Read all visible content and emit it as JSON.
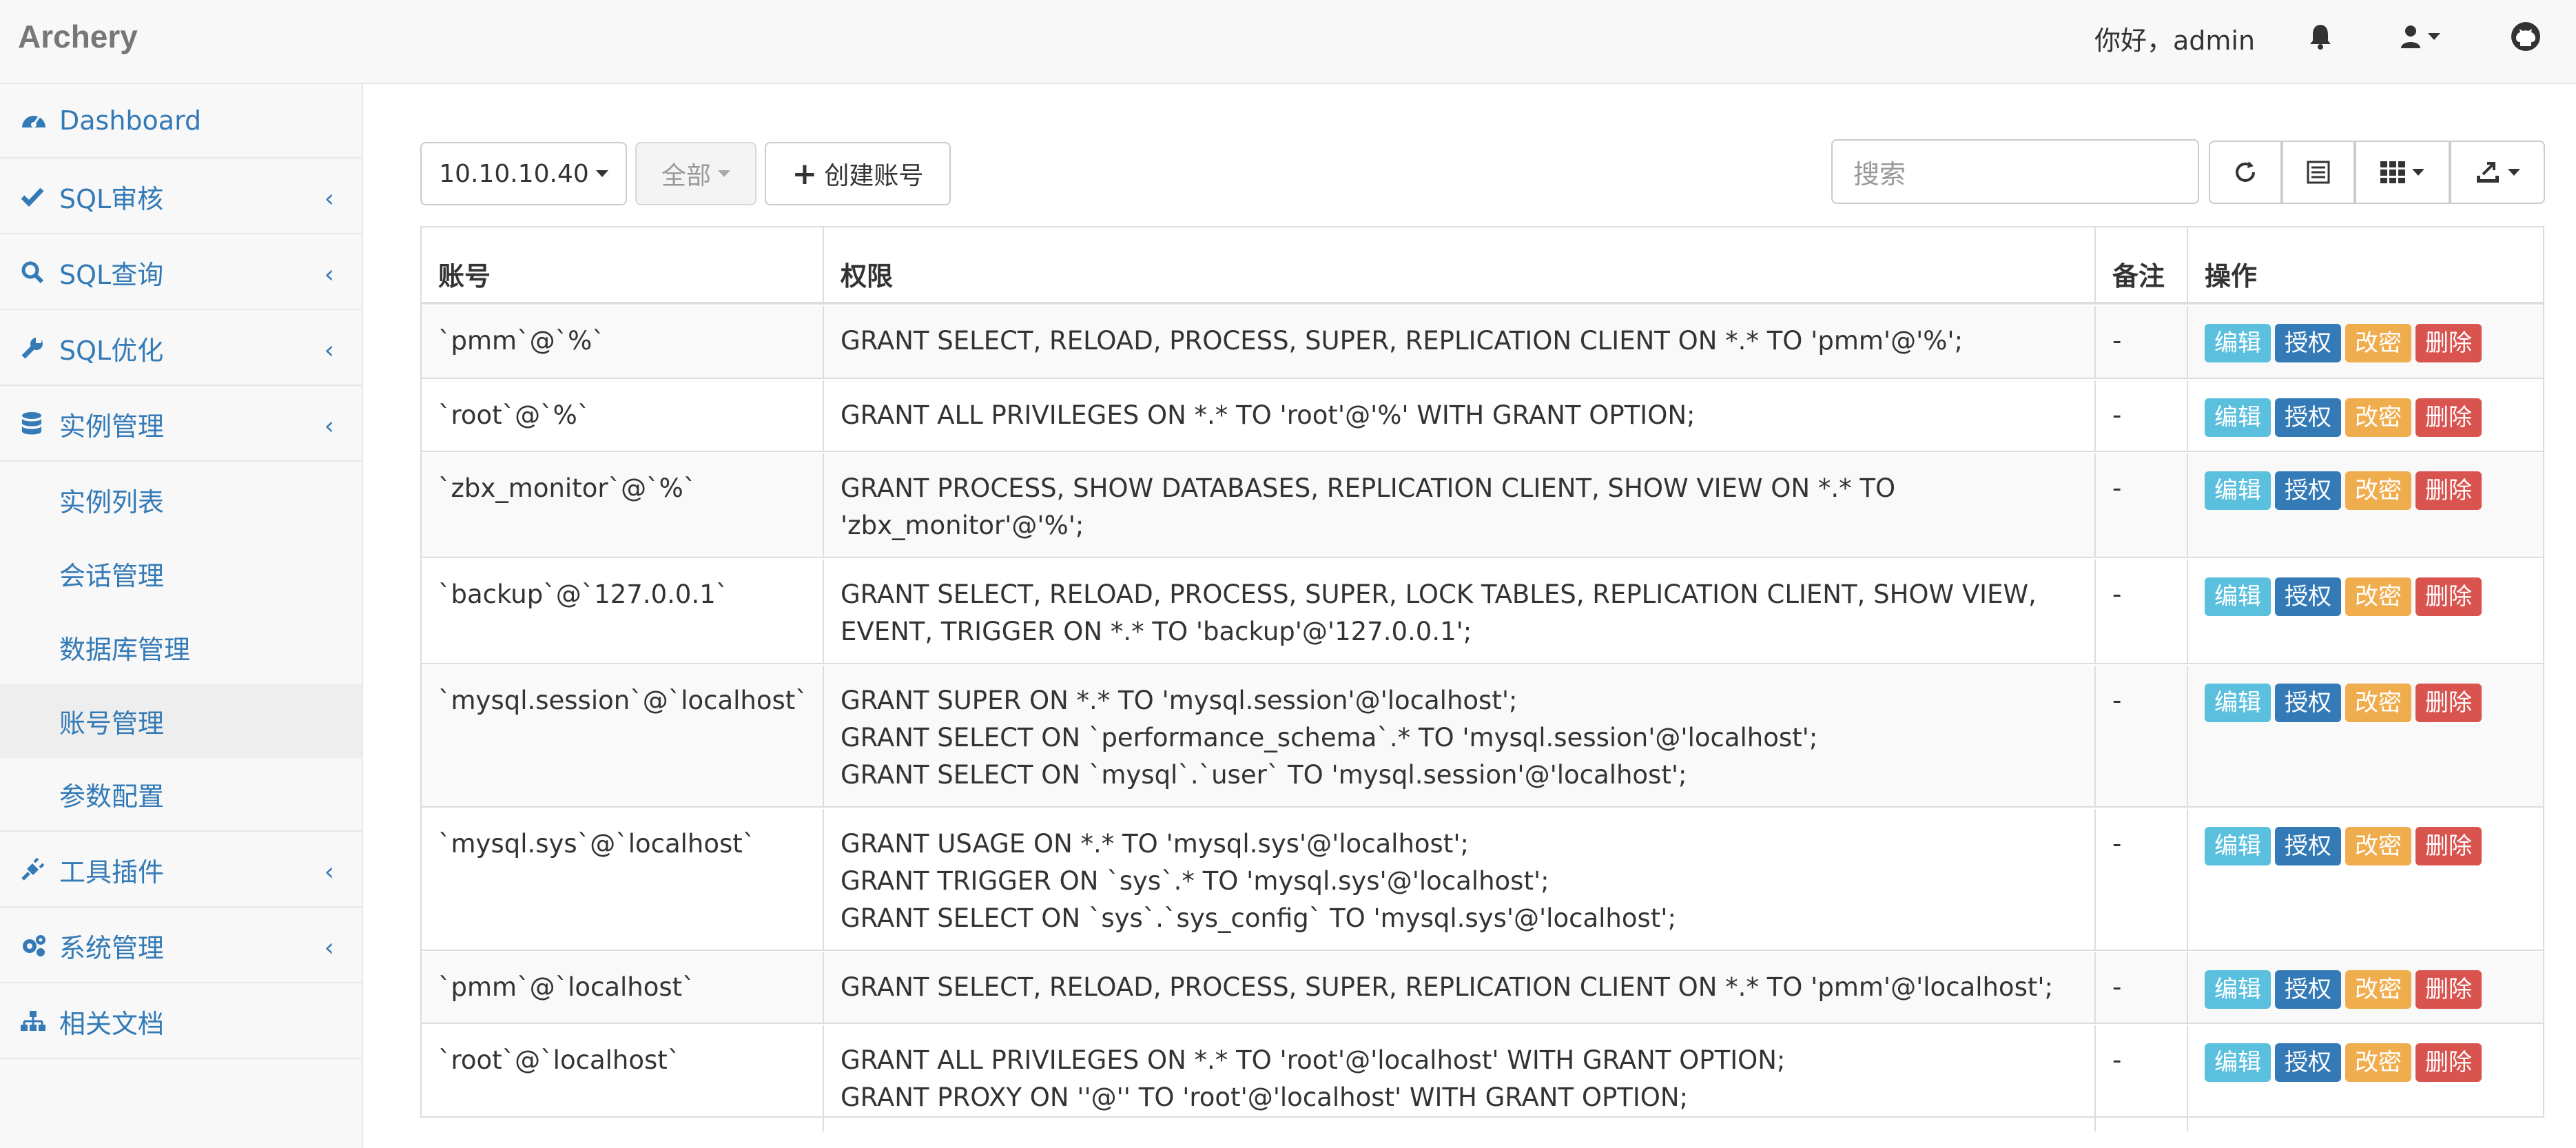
{
  "navbar": {
    "brand": "Archery",
    "greeting": "你好，admin",
    "icons": [
      "bell-icon",
      "user-icon",
      "github-icon"
    ]
  },
  "sidebar": {
    "items": [
      {
        "label": "Dashboard",
        "icon": "dashboard-icon"
      },
      {
        "label": "SQL审核",
        "icon": "check-icon"
      },
      {
        "label": "SQL查询",
        "icon": "search-icon"
      },
      {
        "label": "SQL优化",
        "icon": "wrench-icon"
      },
      {
        "label": "实例管理",
        "icon": "database-icon"
      },
      {
        "label": "工具插件",
        "icon": "plug-icon"
      },
      {
        "label": "系统管理",
        "icon": "cogs-icon"
      },
      {
        "label": "相关文档",
        "icon": "sitemap-icon"
      }
    ],
    "subitems": [
      "实例列表",
      "会话管理",
      "数据库管理",
      "账号管理",
      "参数配置"
    ],
    "active_subitem": "账号管理"
  },
  "toolbar": {
    "instance_select": "10.10.10.40",
    "filter_select": "全部",
    "create_button": "创建账号",
    "search_placeholder": "搜索",
    "icons": [
      "refresh-icon",
      "list-icon",
      "columns-icon",
      "export-icon"
    ]
  },
  "table": {
    "headers": [
      "账号",
      "权限",
      "备注",
      "操作"
    ],
    "actions": [
      "编辑",
      "授权",
      "改密",
      "删除"
    ],
    "rows": [
      {
        "account": "`pmm`@`%`",
        "grants": [
          "GRANT SELECT, RELOAD, PROCESS, SUPER, REPLICATION CLIENT ON *.* TO 'pmm'@'%';"
        ],
        "remark": "-"
      },
      {
        "account": "`root`@`%`",
        "grants": [
          "GRANT ALL PRIVILEGES ON *.* TO 'root'@'%' WITH GRANT OPTION;"
        ],
        "remark": "-"
      },
      {
        "account": "`zbx_monitor`@`%`",
        "grants": [
          "GRANT PROCESS, SHOW DATABASES, REPLICATION CLIENT, SHOW VIEW ON *.* TO",
          "'zbx_monitor'@'%';"
        ],
        "remark": "-"
      },
      {
        "account": "`backup`@`127.0.0.1`",
        "grants": [
          "GRANT SELECT, RELOAD, PROCESS, SUPER, LOCK TABLES, REPLICATION CLIENT, SHOW VIEW,",
          "EVENT, TRIGGER ON *.* TO 'backup'@'127.0.0.1';"
        ],
        "remark": "-"
      },
      {
        "account": "`mysql.session`@`localhost`",
        "grants": [
          "GRANT SUPER ON *.* TO 'mysql.session'@'localhost';",
          "GRANT SELECT ON `performance_schema`.* TO 'mysql.session'@'localhost';",
          "GRANT SELECT ON `mysql`.`user` TO 'mysql.session'@'localhost';"
        ],
        "remark": "-"
      },
      {
        "account": "`mysql.sys`@`localhost`",
        "grants": [
          "GRANT USAGE ON *.* TO 'mysql.sys'@'localhost';",
          "GRANT TRIGGER ON `sys`.* TO 'mysql.sys'@'localhost';",
          "GRANT SELECT ON `sys`.`sys_config` TO 'mysql.sys'@'localhost';"
        ],
        "remark": "-"
      },
      {
        "account": "`pmm`@`localhost`",
        "grants": [
          "GRANT SELECT, RELOAD, PROCESS, SUPER, REPLICATION CLIENT ON *.* TO 'pmm'@'localhost';"
        ],
        "remark": "-"
      },
      {
        "account": "`root`@`localhost`",
        "grants": [
          "GRANT ALL PRIVILEGES ON *.* TO 'root'@'localhost' WITH GRANT OPTION;",
          "GRANT PROXY ON ''@'' TO 'root'@'localhost' WITH GRANT OPTION;"
        ],
        "remark": "-"
      }
    ]
  }
}
